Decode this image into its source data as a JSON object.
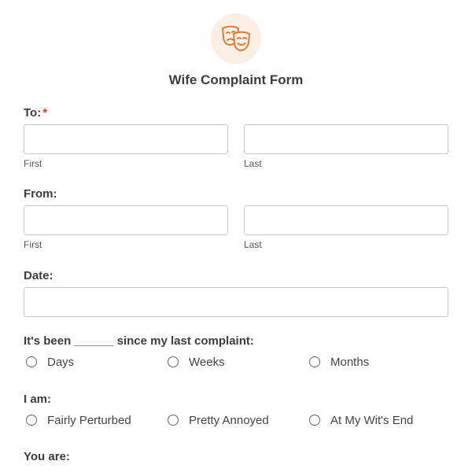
{
  "header": {
    "logo_icon": "theater-masks-icon",
    "accent_color": "#e07b39",
    "title": "Wife Complaint Form"
  },
  "to": {
    "label": "To:",
    "required_mark": "*",
    "first_value": "",
    "last_value": "",
    "first_sublabel": "First",
    "last_sublabel": "Last"
  },
  "from": {
    "label": "From:",
    "first_value": "",
    "last_value": "",
    "first_sublabel": "First",
    "last_sublabel": "Last"
  },
  "date": {
    "label": "Date:",
    "value": ""
  },
  "since": {
    "label": "It's been ______ since my last complaint:",
    "options": [
      "Days",
      "Weeks",
      "Months"
    ]
  },
  "i_am": {
    "label": "I am:",
    "options": [
      "Fairly Perturbed",
      "Pretty Annoyed",
      "At My Wit's End"
    ]
  },
  "you_are": {
    "label": "You are:"
  }
}
